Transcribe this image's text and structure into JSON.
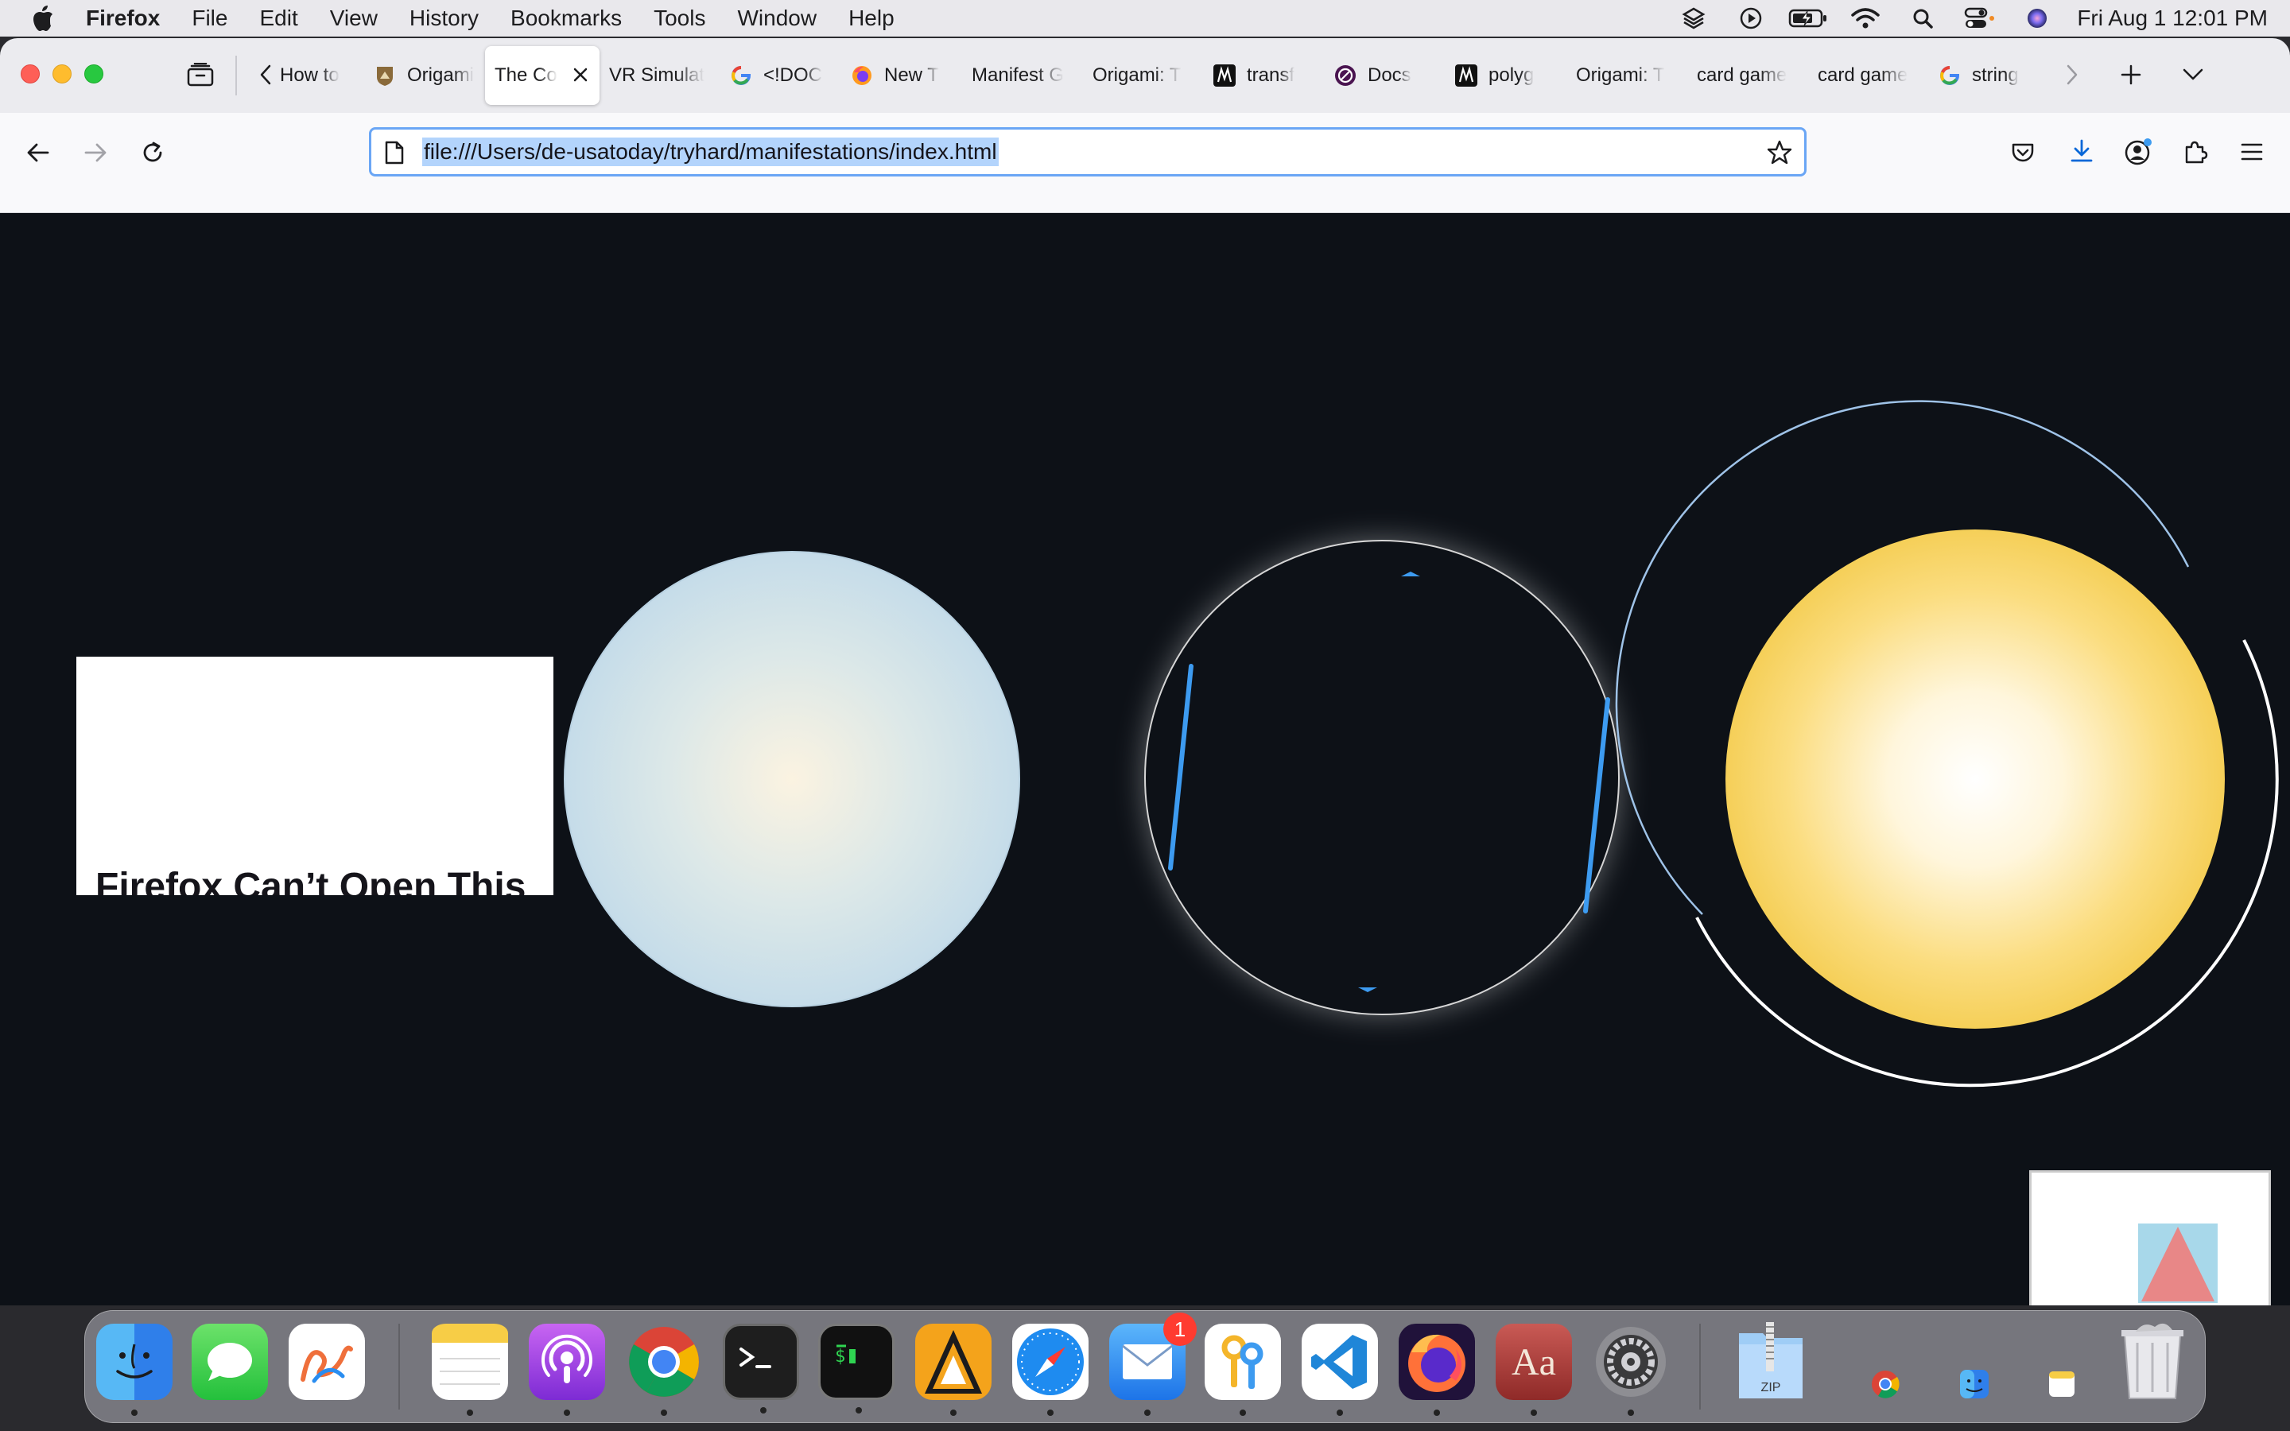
{
  "menubar": {
    "app_name": "Firefox",
    "items": [
      "File",
      "Edit",
      "View",
      "History",
      "Bookmarks",
      "Tools",
      "Window",
      "Help"
    ],
    "clock": "Fri Aug 1  12:01 PM",
    "status_icons": [
      "layers-icon",
      "play-circle-icon",
      "battery-charging-icon",
      "wifi-icon",
      "spotlight-search-icon",
      "control-center-icon",
      "siri-icon"
    ]
  },
  "tabs": [
    {
      "label": "How to",
      "icon": "none"
    },
    {
      "label": "Origami",
      "icon": "trail-badge-icon"
    },
    {
      "label": "The Co",
      "icon": "none",
      "active": true
    },
    {
      "label": "VR Simulat",
      "icon": "none"
    },
    {
      "label": "<!DOC",
      "icon": "google-icon"
    },
    {
      "label": "New T",
      "icon": "firefox-icon"
    },
    {
      "label": "Manifest G",
      "icon": "none"
    },
    {
      "label": "Origami: T",
      "icon": "none"
    },
    {
      "label": "transf",
      "icon": "m-logo-icon"
    },
    {
      "label": "Docs",
      "icon": "docs-circle-icon"
    },
    {
      "label": "polyg",
      "icon": "m-logo-icon"
    },
    {
      "label": "Origami: T",
      "icon": "none"
    },
    {
      "label": "card game",
      "icon": "none"
    },
    {
      "label": "card game",
      "icon": "none"
    },
    {
      "label": "string",
      "icon": "google-icon"
    }
  ],
  "urlbar": {
    "url": "file:///Users/de-usatoday/tryhard/manifestations/index.html"
  },
  "page": {
    "error_title": "Firefox Can’t Open This",
    "colors": {
      "background": "#0d1117",
      "blue_orb": "#cfe3ef",
      "sun_orb": "#f6d35a",
      "accent_blue": "#3d9bf0",
      "triangle": "#e88787",
      "square": "#a8d8ea"
    }
  },
  "dock": {
    "apps": [
      "finder-icon",
      "messages-icon",
      "freeform-icon",
      "notes-icon",
      "podcasts-icon",
      "chrome-icon",
      "terminal-icon",
      "iterm-icon",
      "vlc-icon",
      "safari-icon",
      "mail-icon",
      "keychain-icon",
      "vscode-icon",
      "firefox-icon",
      "dictionary-icon",
      "system-settings-icon",
      "zip-archive-icon",
      "chrome-mini-icon",
      "finder-mini-icon",
      "notes-mini-icon",
      "trash-icon"
    ],
    "mail_badge": "1",
    "dictionary_label": "Aa",
    "zip_label": "ZIP"
  }
}
